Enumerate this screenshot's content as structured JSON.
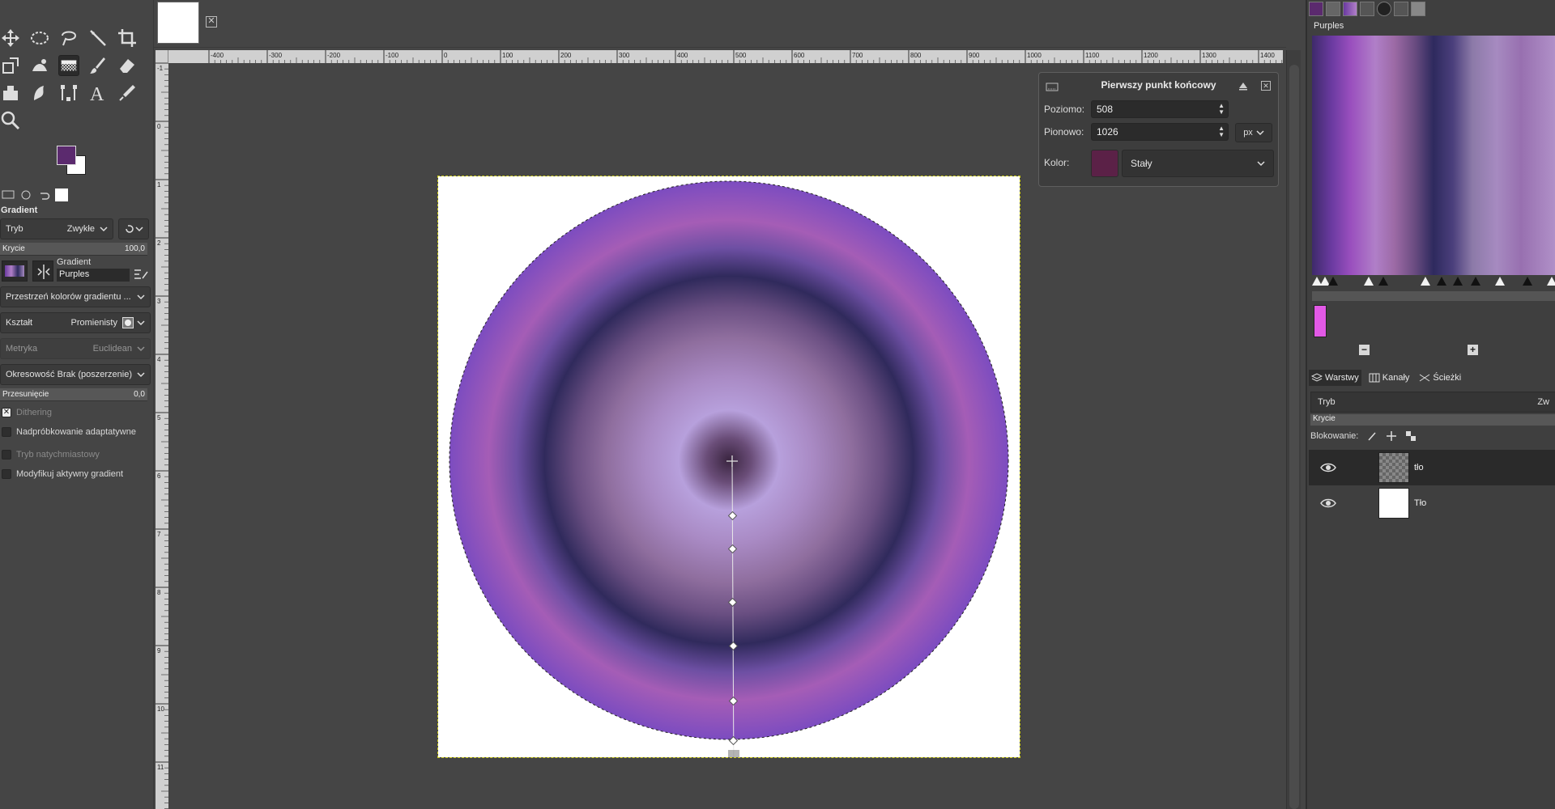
{
  "toolbox": {
    "options_title": "Gradient",
    "mode_label": "Tryb",
    "mode_value": "Zwykłe",
    "opacity_label": "Krycie",
    "opacity_value": "100,0",
    "gradient_label": "Gradient",
    "gradient_value": "Purples",
    "blend_space": "Przestrzeń kolorów gradientu ...",
    "shape_label": "Kształt",
    "shape_value": "Promienisty",
    "metric_label": "Metryka",
    "metric_value": "Euclidean",
    "repeat_label": "Okresowość",
    "repeat_value": "Brak (poszerzenie)",
    "offset_label": "Przesunięcie",
    "offset_value": "0,0",
    "checkboxes": [
      {
        "label": "Dithering",
        "checked": true
      },
      {
        "label": "Nadpróbkowanie adaptatywne",
        "checked": false
      },
      {
        "label": "Tryb natychmiastowy",
        "checked": false
      },
      {
        "label": "Modyfikuj aktywny gradient",
        "checked": false
      }
    ],
    "fg_color": "#5b2a6e",
    "bg_color": "#ffffff"
  },
  "ruler": {
    "h_labels": [
      "-400",
      "-300",
      "-200",
      "-100",
      "0",
      "100",
      "200",
      "300",
      "400",
      "500",
      "600",
      "700",
      "800",
      "900",
      "1000",
      "1100",
      "1200",
      "1300",
      "1400"
    ],
    "v_labels": [
      "-1",
      "0",
      "1",
      "2",
      "3",
      "4",
      "5",
      "6",
      "7",
      "8",
      "9",
      "10",
      "11"
    ]
  },
  "endpoint_dialog": {
    "title": "Pierwszy punkt końcowy",
    "x_label": "Poziomo:",
    "x_value": "508",
    "y_label": "Pionowo:",
    "y_value": "1026",
    "unit": "px",
    "color_label": "Kolor:",
    "color_value": "Stały",
    "swatch_color": "#5b2147"
  },
  "dock": {
    "gradient_name": "Purples",
    "layers_tab": "Warstwy",
    "channels_tab": "Kanały",
    "paths_tab": "Ścieżki",
    "mode_label": "Tryb",
    "mode_value": "Zw",
    "opacity_label": "Krycie",
    "lock_label": "Blokowanie:",
    "layers": [
      {
        "name": "tło",
        "thumb": "transparent",
        "selected": true
      },
      {
        "name": "Tło",
        "thumb": "white",
        "selected": false
      }
    ]
  }
}
